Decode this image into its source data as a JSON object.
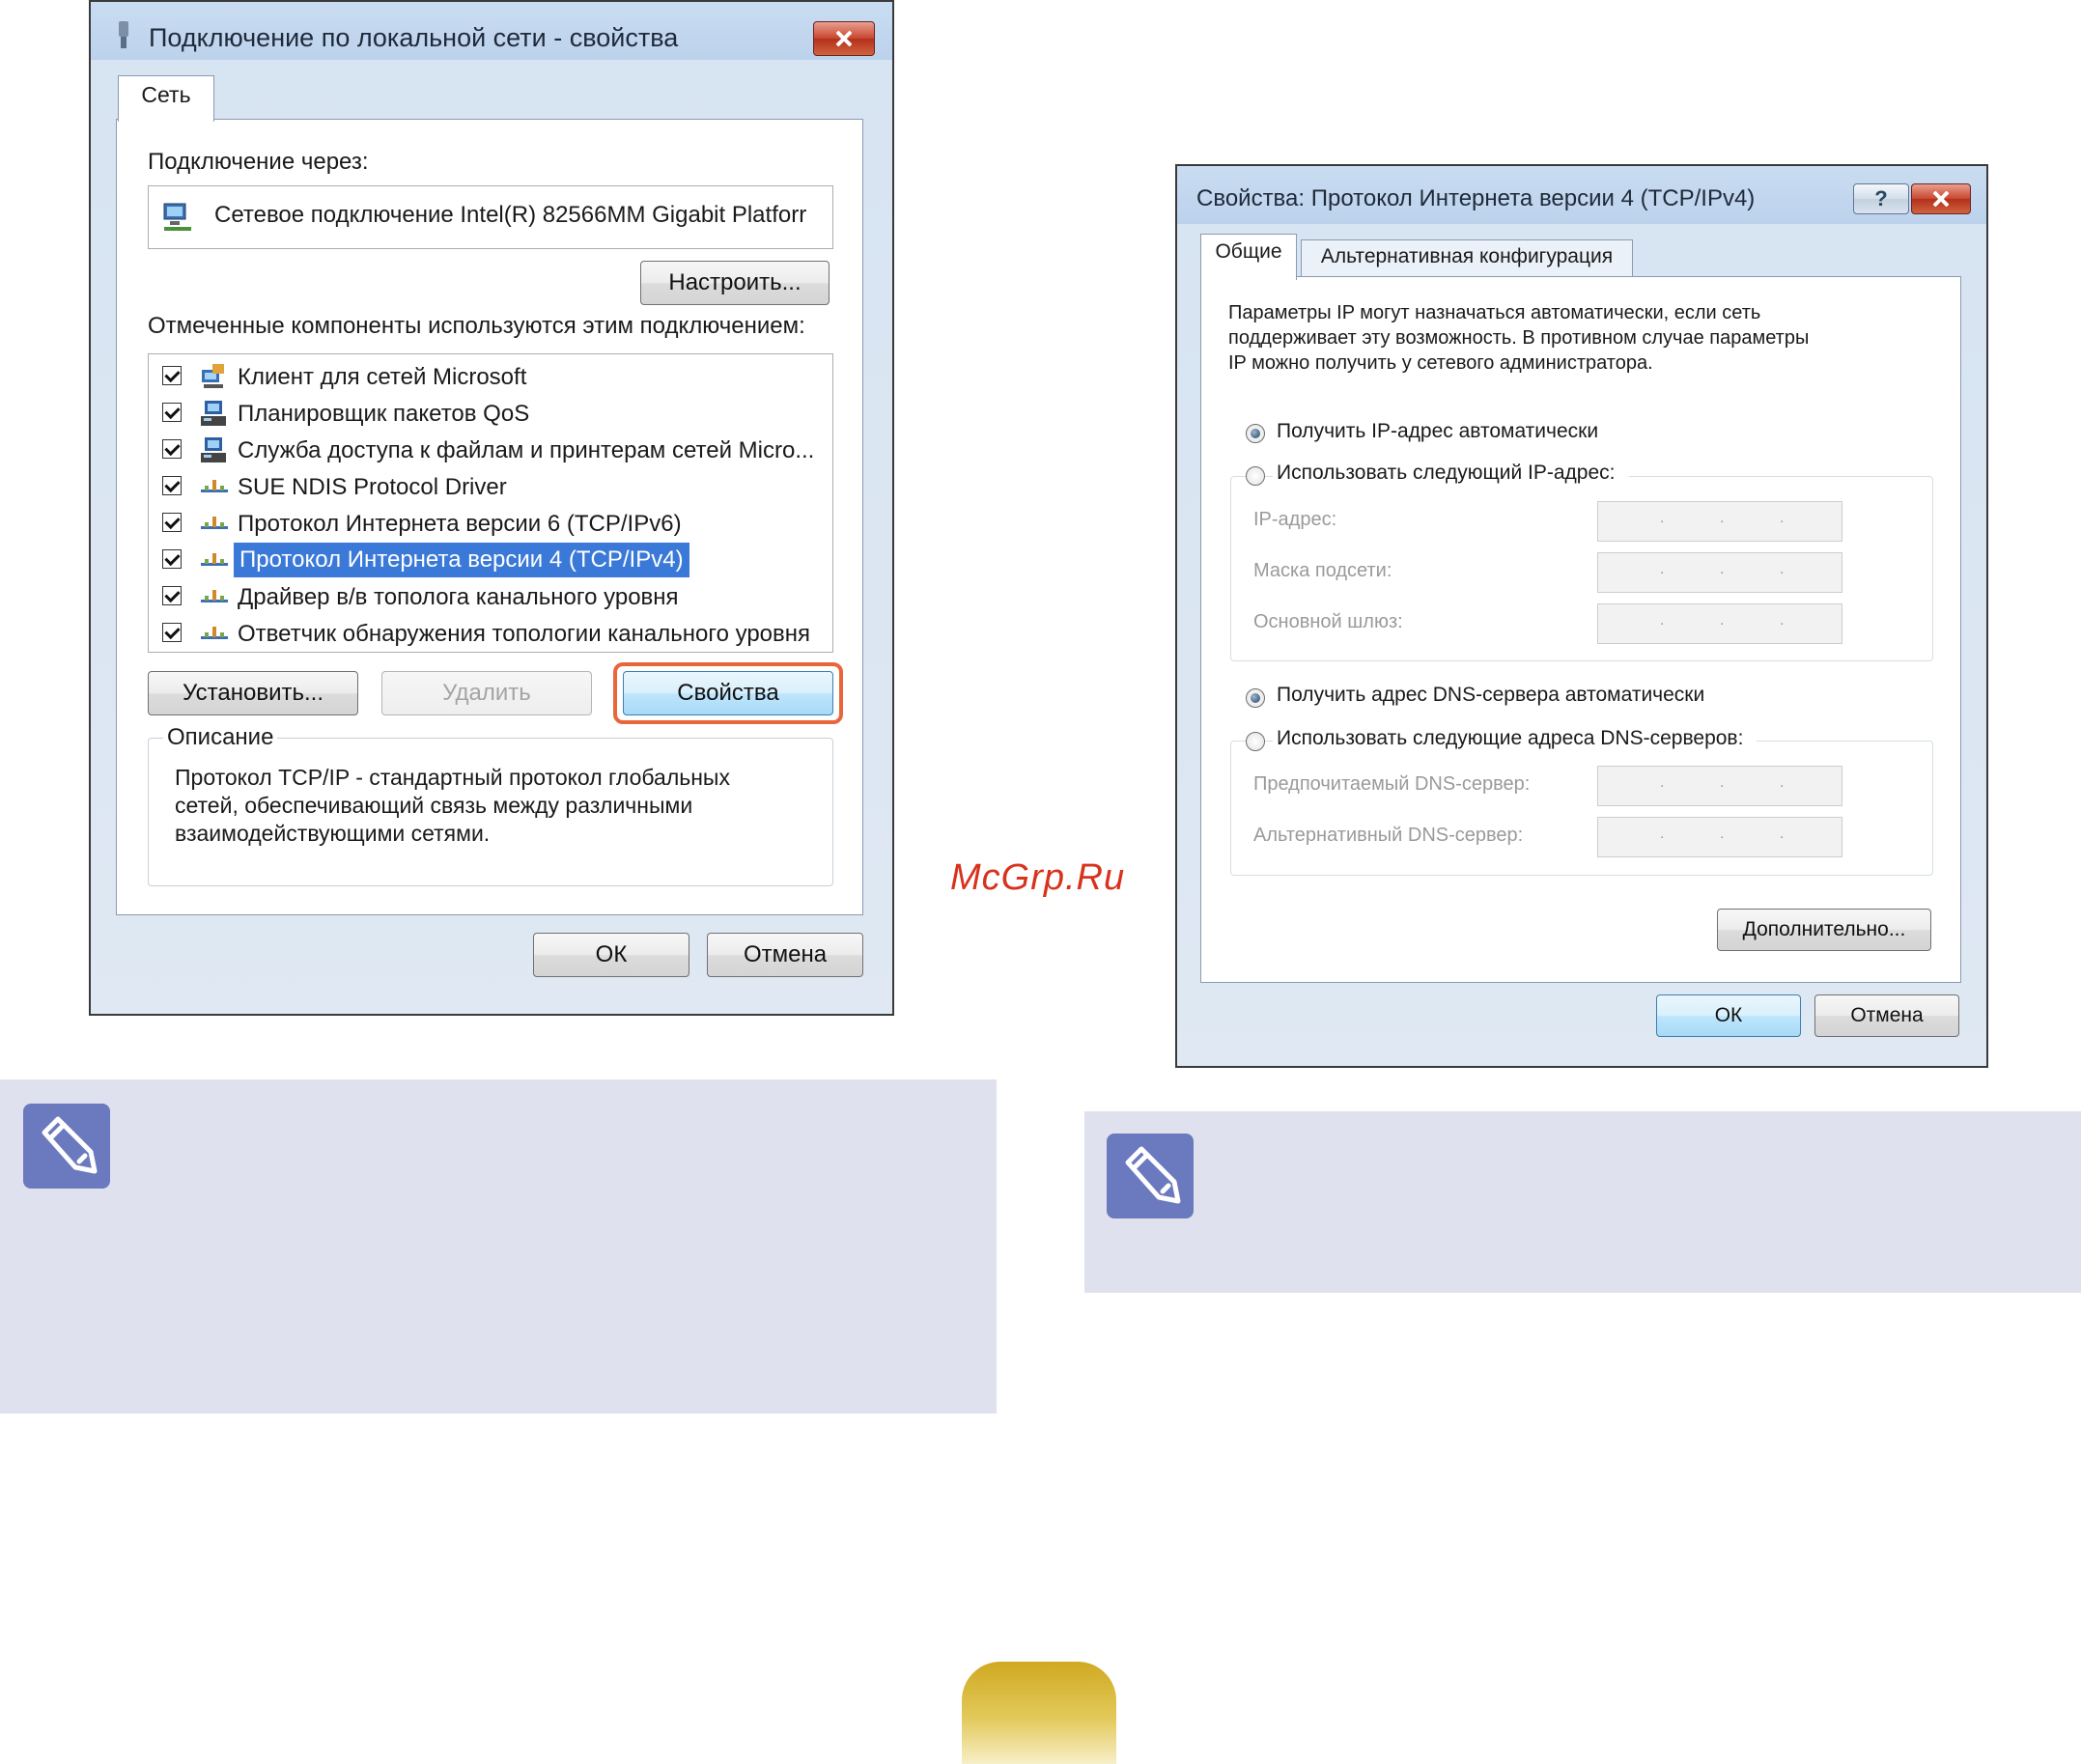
{
  "dialog1": {
    "title": "Подключение по локальной сети - свойства",
    "tab": "Сеть",
    "connect_via_label": "Подключение через:",
    "adapter": "Сетевое подключение Intel(R) 82566MM Gigabit Platforr",
    "configure_button": "Настроить...",
    "components_label": "Отмеченные компоненты используются этим подключением:",
    "components": [
      {
        "label": "Клиент для сетей Microsoft",
        "checked": true,
        "icon": "network-client-icon"
      },
      {
        "label": "Планировщик пакетов QoS",
        "checked": true,
        "icon": "network-service-icon"
      },
      {
        "label": "Служба доступа к файлам и принтерам сетей Micro...",
        "checked": true,
        "icon": "network-service-icon"
      },
      {
        "label": "SUE NDIS Protocol Driver",
        "checked": true,
        "icon": "protocol-icon"
      },
      {
        "label": "Протокол Интернета версии 6 (TCP/IPv6)",
        "checked": true,
        "icon": "protocol-icon"
      },
      {
        "label": "Протокол Интернета версии 4 (TCP/IPv4)",
        "checked": true,
        "icon": "protocol-icon",
        "selected": true
      },
      {
        "label": "Драйвер в/в тополога канального уровня",
        "checked": true,
        "icon": "protocol-icon"
      },
      {
        "label": "Ответчик обнаружения топологии канального уровня",
        "checked": true,
        "icon": "protocol-icon"
      }
    ],
    "install_button": "Установить...",
    "remove_button": "Удалить",
    "properties_button": "Свойства",
    "description_label": "Описание",
    "description_lines": [
      "Протокол TCP/IP - стандартный протокол глобальных",
      "сетей, обеспечивающий связь между различными",
      "взаимодействующими сетями."
    ],
    "ok_button": "ОК",
    "cancel_button": "Отмена"
  },
  "dialog2": {
    "title": "Свойства: Протокол Интернета версии 4 (TCP/IPv4)",
    "help_button": "?",
    "tabs": [
      "Общие",
      "Альтернативная конфигурация"
    ],
    "intro_lines": [
      "Параметры IP могут назначаться автоматически, если сеть",
      "поддерживает эту возможность. В противном случае параметры",
      "IP можно получить у сетевого администратора."
    ],
    "radio_ip_auto": "Получить IP-адрес автоматически",
    "radio_ip_manual": "Использовать следующий IP-адрес:",
    "ip_address_label": "IP-адрес:",
    "subnet_mask_label": "Маска подсети:",
    "gateway_label": "Основной шлюз:",
    "radio_dns_auto": "Получить адрес DNS-сервера автоматически",
    "radio_dns_manual": "Использовать следующие адреса DNS-серверов:",
    "preferred_dns_label": "Предпочитаемый DNS-сервер:",
    "alternate_dns_label": "Альтернативный DNS-сервер:",
    "advanced_button": "Дополнительно...",
    "ok_button": "ОК",
    "cancel_button": "Отмена",
    "ip_dot": "."
  },
  "watermark": "McGrp.Ru",
  "colors": {
    "highlight_outline": "#e8663a",
    "selection": "#3b79d8",
    "note_background": "#dfe1ef",
    "note_icon": "#6b79bf",
    "page_tab": "#d8b836"
  }
}
